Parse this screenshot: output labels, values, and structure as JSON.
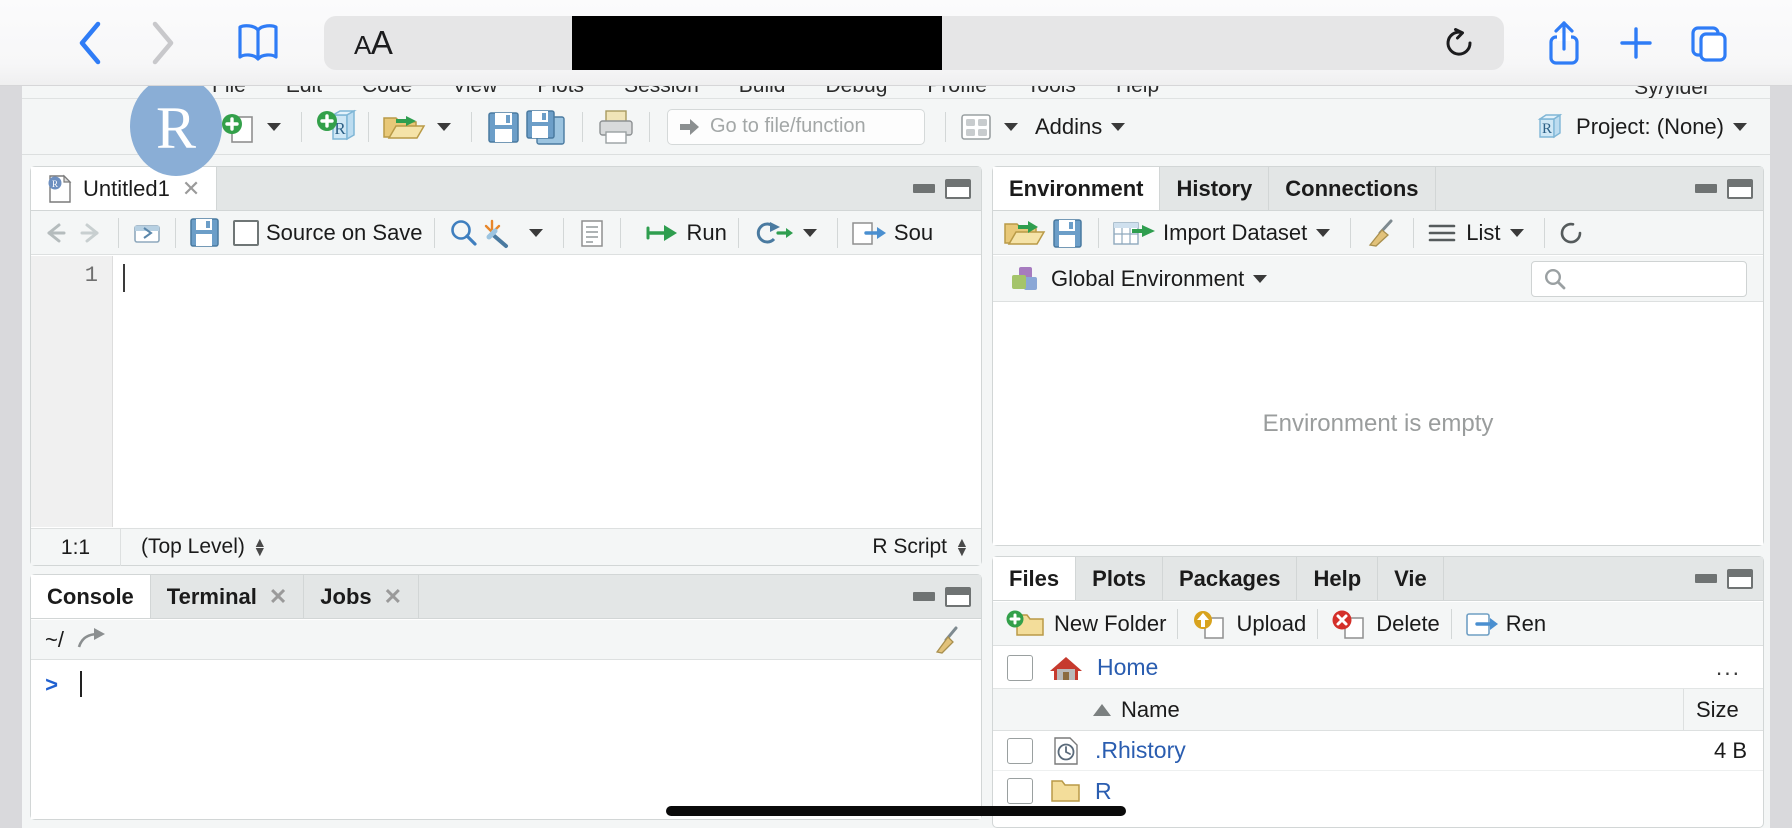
{
  "browser": {
    "back_icon": "chevron-left-icon",
    "forward_icon": "chevron-right-icon",
    "bookmarks_icon": "book-icon",
    "text_size_label_small": "A",
    "text_size_label_large": "A",
    "url_value": "",
    "url_placeholder": "",
    "reload_icon": "reload-icon",
    "share_icon": "share-icon",
    "new_tab_icon": "plus-icon",
    "tabs_icon": "tabs-icon"
  },
  "rstudio": {
    "menus": [
      "File",
      "Edit",
      "Code",
      "View",
      "Plots",
      "Session",
      "Build",
      "Debug",
      "Profile",
      "Tools",
      "Help"
    ],
    "menu_right": "Sy/ylder",
    "toolbar": {
      "new_file_icon": "new-file-icon",
      "new_project_icon": "new-project-icon",
      "open_file_icon": "open-folder-icon",
      "save_icon": "save-icon",
      "save_all_icon": "save-all-icon",
      "print_icon": "print-icon",
      "goto_placeholder": "Go to file/function",
      "panes_icon": "panes-layout-icon",
      "addins_label": "Addins",
      "project_icon": "r-project-icon",
      "project_label": "Project: (None)"
    },
    "source": {
      "tab_label": "Untitled1",
      "tab_icon": "r-script-file-icon",
      "tab_close_icon": "close-icon",
      "back_icon": "arrow-left-icon",
      "forward_icon": "arrow-right-icon",
      "popout_icon": "show-in-new-window-icon",
      "save_icon": "save-icon",
      "source_on_save_label": "Source on Save",
      "find_icon": "magnifier-icon",
      "magic_icon": "code-tools-icon",
      "compile_report_icon": "compile-report-icon",
      "run_label": "Run",
      "run_icon": "run-icon",
      "rerun_icon": "rerun-icon",
      "source_label": "Sou",
      "source_icon": "source-icon",
      "line_number": "1",
      "cursor_position": "1:1",
      "scope_label": "(Top Level)",
      "file_type_label": "R Script"
    },
    "console": {
      "tabs": [
        {
          "label": "Console",
          "active": true,
          "closable": false
        },
        {
          "label": "Terminal",
          "active": false,
          "closable": true
        },
        {
          "label": "Jobs",
          "active": false,
          "closable": true
        }
      ],
      "working_dir": "~/",
      "dir_link_icon": "open-in-window-icon",
      "clear_icon": "broom-icon",
      "prompt": ">"
    },
    "environment": {
      "tabs": [
        {
          "label": "Environment",
          "active": true
        },
        {
          "label": "History",
          "active": false
        },
        {
          "label": "Connections",
          "active": false
        }
      ],
      "load_icon": "open-folder-icon",
      "save_icon": "save-icon",
      "import_label": "Import Dataset",
      "import_icon": "import-dataset-icon",
      "clear_icon": "broom-icon",
      "list_label": "List",
      "list_icon": "list-icon",
      "refresh_icon": "refresh-icon",
      "scope_label": "Global Environment",
      "scope_icon": "environment-icon",
      "search_placeholder": "",
      "search_icon": "search-icon",
      "empty_message": "Environment is empty"
    },
    "files": {
      "tabs": [
        {
          "label": "Files",
          "active": true
        },
        {
          "label": "Plots",
          "active": false
        },
        {
          "label": "Packages",
          "active": false
        },
        {
          "label": "Help",
          "active": false
        },
        {
          "label": "Vie",
          "active": false
        }
      ],
      "new_folder_label": "New Folder",
      "new_folder_icon": "new-folder-icon",
      "upload_label": "Upload",
      "upload_icon": "upload-icon",
      "delete_label": "Delete",
      "delete_icon": "delete-icon",
      "rename_label": "Ren",
      "rename_icon": "rename-icon",
      "breadcrumb_home": "Home",
      "breadcrumb_home_icon": "home-icon",
      "breadcrumb_more": "...",
      "columns": [
        "Name",
        "Size"
      ],
      "rows": [
        {
          "name": ".Rhistory",
          "size": "4 B",
          "icon": "history-file-icon"
        },
        {
          "name": "R",
          "size": "",
          "icon": "folder-icon"
        }
      ]
    }
  },
  "colors": {
    "ios_blue": "#2f7cf6",
    "link_blue": "#2a5db0",
    "pane_bg": "#f4f6f6"
  }
}
